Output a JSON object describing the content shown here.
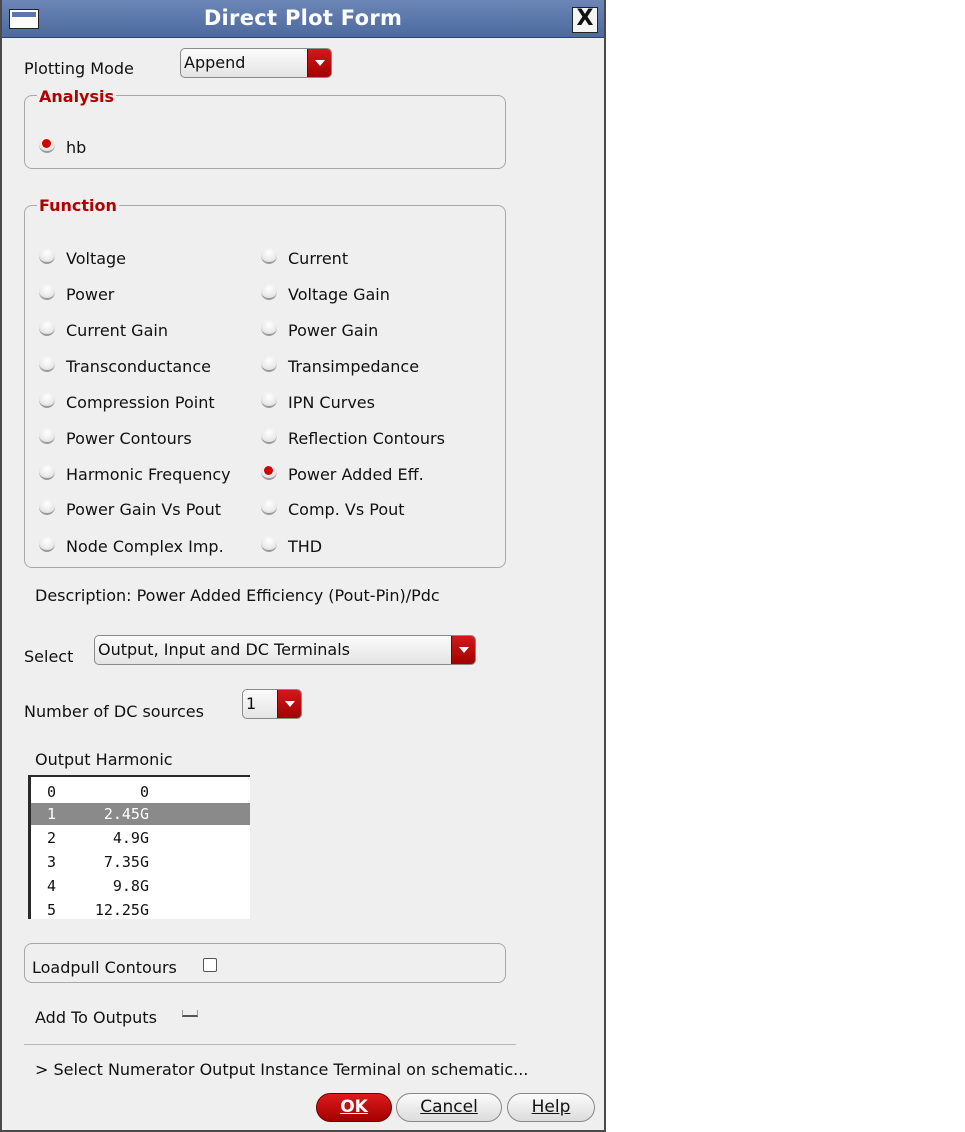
{
  "window": {
    "title": "Direct Plot Form",
    "close_glyph": "X"
  },
  "plotting_mode": {
    "label": "Plotting Mode",
    "value": "Append"
  },
  "analysis": {
    "title": "Analysis",
    "option": "hb",
    "selected": true
  },
  "function": {
    "title": "Function",
    "options": [
      {
        "label": "Voltage",
        "selected": false
      },
      {
        "label": "Current",
        "selected": false
      },
      {
        "label": "Power",
        "selected": false
      },
      {
        "label": "Voltage Gain",
        "selected": false
      },
      {
        "label": "Current Gain",
        "selected": false
      },
      {
        "label": "Power Gain",
        "selected": false
      },
      {
        "label": "Transconductance",
        "selected": false
      },
      {
        "label": "Transimpedance",
        "selected": false
      },
      {
        "label": "Compression Point",
        "selected": false
      },
      {
        "label": "IPN Curves",
        "selected": false
      },
      {
        "label": "Power Contours",
        "selected": false
      },
      {
        "label": "Reflection Contours",
        "selected": false
      },
      {
        "label": "Harmonic Frequency",
        "selected": false
      },
      {
        "label": "Power Added Eff.",
        "selected": true
      },
      {
        "label": "Power Gain Vs Pout",
        "selected": false
      },
      {
        "label": "Comp. Vs Pout",
        "selected": false
      },
      {
        "label": "Node Complex Imp.",
        "selected": false
      },
      {
        "label": "THD",
        "selected": false
      }
    ]
  },
  "description": "Description: Power Added Efficiency (Pout-Pin)/Pdc",
  "select": {
    "label": "Select",
    "value": "Output, Input and DC Terminals"
  },
  "dc_sources": {
    "label": "Number of DC sources",
    "value": "1"
  },
  "output_harmonic": {
    "label": "Output Harmonic",
    "rows": [
      {
        "index": "0",
        "freq": "0",
        "selected": false
      },
      {
        "index": "1",
        "freq": "2.45G",
        "selected": true
      },
      {
        "index": "2",
        "freq": "4.9G",
        "selected": false
      },
      {
        "index": "3",
        "freq": "7.35G",
        "selected": false
      },
      {
        "index": "4",
        "freq": "9.8G",
        "selected": false
      },
      {
        "index": "5",
        "freq": "12.25G",
        "selected": false
      }
    ]
  },
  "loadpull": {
    "label": "Loadpull Contours",
    "checked": false
  },
  "add_to_outputs": {
    "label": "Add To Outputs",
    "checked": false
  },
  "status": "> Select Numerator Output Instance Terminal on schematic...",
  "buttons": {
    "ok": "OK",
    "cancel": "Cancel",
    "help": "Help"
  },
  "colors": {
    "accent_red": "#b10000",
    "title_blue": "#5b76a8",
    "panel_gray": "#efefef"
  }
}
